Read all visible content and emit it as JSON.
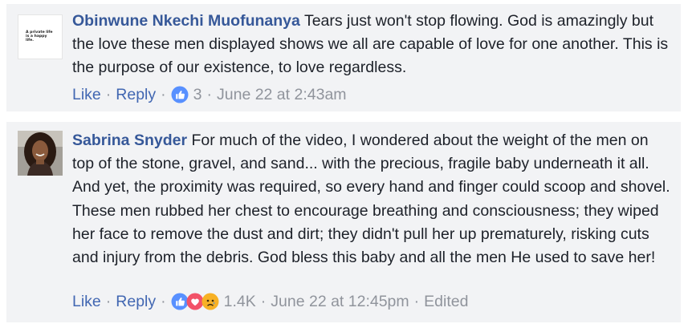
{
  "comments": [
    {
      "author": "Obinwune Nkechi Muofunanya",
      "text": "Tears just won't stop flowing. God is amazingly but the love these men displayed shows we all are capable of love for one another. This is the purpose of our existence, to love regardless.",
      "avatar_text": "A private life is a happy life.",
      "like_label": "Like",
      "reply_label": "Reply",
      "reaction_count": "3",
      "reaction_icons": [
        "like-icon"
      ],
      "timestamp": "June 22 at 2:43am",
      "edited_label": ""
    },
    {
      "author": "Sabrina Snyder",
      "text": "For much of the video, I wondered about the weight of the men on top of the stone, gravel, and sand... with the precious, fragile baby underneath it all. And yet, the proximity was required, so every hand and finger could scoop and shovel. These men rubbed her chest to encourage breathing and consciousness; they wiped her face to remove the dust and dirt; they didn't pull her up prematurely, risking cuts and injury from the debris. God bless this baby and all the men He used to save her!",
      "like_label": "Like",
      "reply_label": "Reply",
      "reaction_count": "1.4K",
      "reaction_icons": [
        "like-icon",
        "love-icon",
        "sad-icon"
      ],
      "timestamp": "June 22 at 12:45pm",
      "edited_label": "Edited"
    }
  ],
  "colors": {
    "author": "#365899",
    "action_link": "#4267b2",
    "meta": "#90949c",
    "comment_bg": "#f2f3f5",
    "like_blue": "#5890ff",
    "love_red": "#f25268",
    "sad_yellow": "#f7b125"
  }
}
